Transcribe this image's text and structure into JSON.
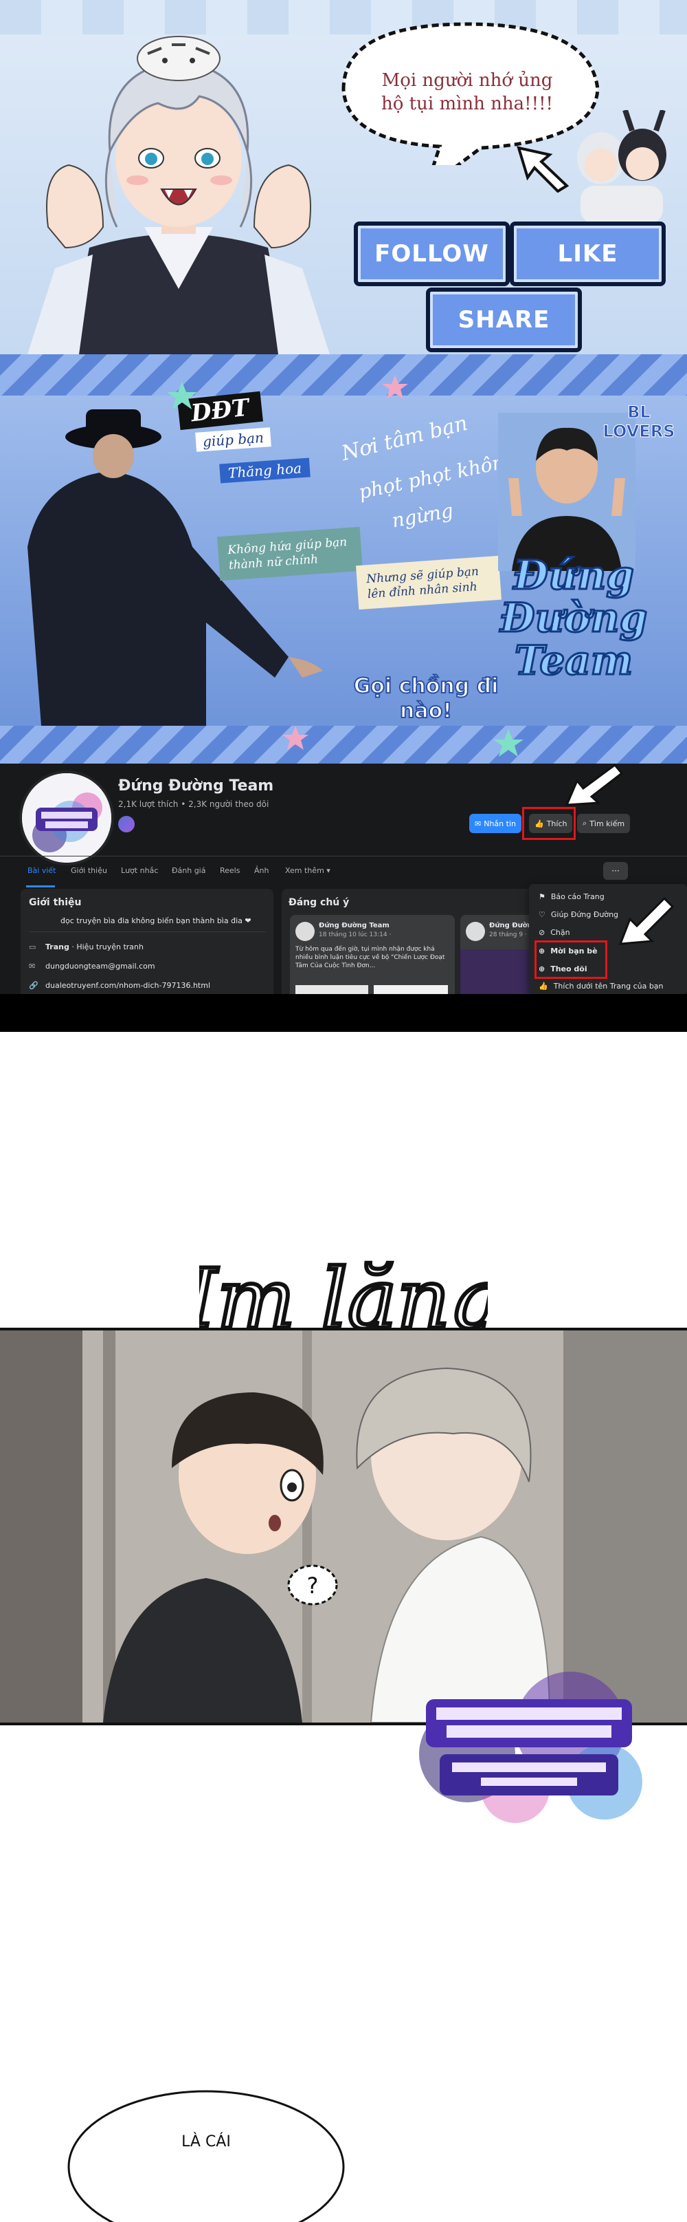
{
  "banner_top": {
    "speech_bubble_text": "Mọi người nhớ ủng hộ tụi mình nha!!!!",
    "buttons": {
      "follow": "FOLLOW",
      "like": "LIKE",
      "share": "SHARE"
    },
    "colors": {
      "button_fill": "#6d97ea",
      "button_border": "#0b1a3b",
      "bubble_text": "#8a2f3a"
    }
  },
  "banner_cover": {
    "tag_ddt": "DĐT",
    "tag_giup_ban": "giúp bạn",
    "tag_thang_hoa": "Thăng hoa",
    "script_line_1": "Nơi tâm bạn",
    "script_line_2": "phọt phọt không",
    "script_line_3": "ngừng",
    "note_left": "Không hứa giúp bạn thành nữ chính",
    "note_right": "Nhưng sẽ giúp bạn lên đỉnh nhân sinh",
    "bl_lovers": "BL LOVERS",
    "logo_text": "Đứng Đường Team",
    "call_to_action": "Gọi chồng đi nào!"
  },
  "facebook": {
    "page_name": "Đứng Đường Team",
    "stats": "2,1K lượt thích • 2,3K người theo dõi",
    "buttons": {
      "message": "Nhắn tin",
      "like": "Thích",
      "search": "Tìm kiếm"
    },
    "tabs": [
      "Bài viết",
      "Giới thiệu",
      "Lượt nhắc",
      "Đánh giá",
      "Reels",
      "Ảnh",
      "Xem thêm ▾"
    ],
    "more_button": "···",
    "intro": {
      "title": "Giới thiệu",
      "description": "đọc truyện bìa đia không biến bạn thành bìa đia ❤",
      "category_label": "Trang",
      "category_value": "· Hiệu truyện tranh",
      "email": "dungduongteam@gmail.com",
      "link": "dualeotruyenf.com/nhom-dich-797136.html"
    },
    "featured": {
      "title": "Đáng chú ý",
      "post1": {
        "author": "Đứng Đường Team",
        "time": "18 tháng 10 lúc 13:14 ·",
        "text": "Từ hôm qua đến giờ, tụi mình nhận được khá nhiều bình luận tiêu cực về bộ \"Chiến Lược Đoạt Tâm Của Cuộc Tình Đơn..."
      },
      "post2": {
        "author": "Đứng Đường",
        "time": "28 tháng 9 ·"
      }
    },
    "menu": [
      "Báo cáo Trang",
      "Giúp Đứng Đường",
      "Chặn",
      "Mời bạn bè",
      "Theo dõi",
      "Thích dưới tên Trang của bạn"
    ],
    "colors": {
      "bg": "#18191a",
      "card": "#242526",
      "blue": "#2d88ff",
      "highlight": "#e0161b"
    }
  },
  "comic": {
    "sfx": "Im lặng",
    "bubble_mark": "?",
    "final_bubble_text": "LÀ CÁI"
  }
}
